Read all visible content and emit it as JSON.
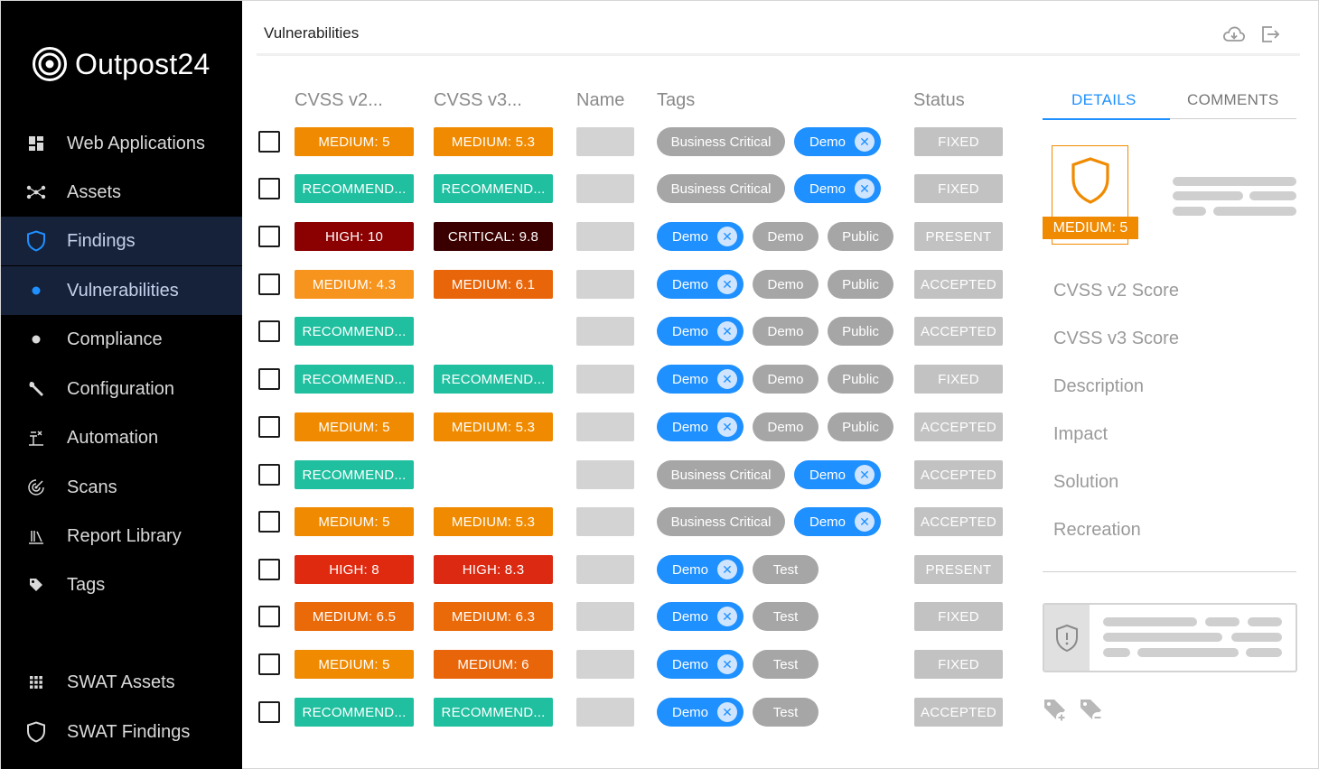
{
  "app": {
    "brand": "Outpost24",
    "page_title": "Vulnerabilities"
  },
  "sidebar": {
    "items": [
      {
        "label": "Web Applications",
        "icon": "grid-icon"
      },
      {
        "label": "Assets",
        "icon": "network-icon"
      },
      {
        "label": "Findings",
        "icon": "shield-icon"
      },
      {
        "label": "Vulnerabilities",
        "icon": "dot-icon"
      },
      {
        "label": "Compliance",
        "icon": "dot-icon"
      },
      {
        "label": "Configuration",
        "icon": "wrench-icon"
      },
      {
        "label": "Automation",
        "icon": "automation-icon"
      },
      {
        "label": "Scans",
        "icon": "radar-icon"
      },
      {
        "label": "Report Library",
        "icon": "library-icon"
      },
      {
        "label": "Tags",
        "icon": "tag-icon"
      },
      {
        "label": "SWAT Assets",
        "icon": "apps-grid-icon"
      },
      {
        "label": "SWAT Findings",
        "icon": "shield-outline-icon"
      }
    ]
  },
  "table": {
    "columns": [
      "CVSS v2...",
      "CVSS v3...",
      "Name",
      "Tags",
      "Status"
    ],
    "rows": [
      {
        "v2": "MEDIUM: 5",
        "v3": "MEDIUM: 5.3",
        "tags": [
          {
            "label": "Business Critical",
            "style": "grey"
          },
          {
            "label": "Demo",
            "style": "blue"
          }
        ],
        "status": "FIXED"
      },
      {
        "v2": "RECOMMEND...",
        "v3": "RECOMMEND...",
        "tags": [
          {
            "label": "Business Critical",
            "style": "grey"
          },
          {
            "label": "Demo",
            "style": "blue"
          }
        ],
        "status": "FIXED"
      },
      {
        "v2": "HIGH: 10",
        "v3": "CRITICAL: 9.8",
        "tags": [
          {
            "label": "Demo",
            "style": "blue"
          },
          {
            "label": "Demo",
            "style": "grey"
          },
          {
            "label": "Public",
            "style": "grey"
          }
        ],
        "status": "PRESENT"
      },
      {
        "v2": "MEDIUM: 4.3",
        "v3": "MEDIUM: 6.1",
        "tags": [
          {
            "label": "Demo",
            "style": "blue"
          },
          {
            "label": "Demo",
            "style": "grey"
          },
          {
            "label": "Public",
            "style": "grey"
          }
        ],
        "status": "ACCEPTED"
      },
      {
        "v2": "RECOMMEND...",
        "v3": "",
        "tags": [
          {
            "label": "Demo",
            "style": "blue"
          },
          {
            "label": "Demo",
            "style": "grey"
          },
          {
            "label": "Public",
            "style": "grey"
          }
        ],
        "status": "ACCEPTED"
      },
      {
        "v2": "RECOMMEND...",
        "v3": "RECOMMEND...",
        "tags": [
          {
            "label": "Demo",
            "style": "blue"
          },
          {
            "label": "Demo",
            "style": "grey"
          },
          {
            "label": "Public",
            "style": "grey"
          }
        ],
        "status": "FIXED"
      },
      {
        "v2": "MEDIUM: 5",
        "v3": "MEDIUM: 5.3",
        "tags": [
          {
            "label": "Demo",
            "style": "blue"
          },
          {
            "label": "Demo",
            "style": "grey"
          },
          {
            "label": "Public",
            "style": "grey"
          }
        ],
        "status": "ACCEPTED"
      },
      {
        "v2": "RECOMMEND...",
        "v3": "",
        "tags": [
          {
            "label": "Business Critical",
            "style": "grey"
          },
          {
            "label": "Demo",
            "style": "blue"
          }
        ],
        "status": "ACCEPTED"
      },
      {
        "v2": "MEDIUM: 5",
        "v3": "MEDIUM: 5.3",
        "tags": [
          {
            "label": "Business Critical",
            "style": "grey"
          },
          {
            "label": "Demo",
            "style": "blue"
          }
        ],
        "status": "ACCEPTED"
      },
      {
        "v2": "HIGH: 8",
        "v3": "HIGH: 8.3",
        "tags": [
          {
            "label": "Demo",
            "style": "blue"
          },
          {
            "label": "Test",
            "style": "grey"
          }
        ],
        "status": "PRESENT"
      },
      {
        "v2": "MEDIUM: 6.5",
        "v3": "MEDIUM: 6.3",
        "tags": [
          {
            "label": "Demo",
            "style": "blue"
          },
          {
            "label": "Test",
            "style": "grey"
          }
        ],
        "status": "FIXED"
      },
      {
        "v2": "MEDIUM: 5",
        "v3": "MEDIUM: 6",
        "tags": [
          {
            "label": "Demo",
            "style": "blue"
          },
          {
            "label": "Test",
            "style": "grey"
          }
        ],
        "status": "FIXED"
      },
      {
        "v2": "RECOMMEND...",
        "v3": "RECOMMEND...",
        "tags": [
          {
            "label": "Demo",
            "style": "blue"
          },
          {
            "label": "Test",
            "style": "grey"
          }
        ],
        "status": "ACCEPTED"
      }
    ]
  },
  "severity_colors": {
    "MEDIUM: 5": "#f08a00",
    "MEDIUM: 5.3": "#f08a00",
    "RECOMMEND...": "#1fbf9f",
    "HIGH: 10": "#8b0000",
    "CRITICAL: 9.8": "#3a0000",
    "MEDIUM: 4.3": "#f7941d",
    "MEDIUM: 6.1": "#e8650a",
    "HIGH: 8": "#e02a10",
    "HIGH: 8.3": "#dc2a12",
    "MEDIUM: 6.5": "#ea6a0a",
    "MEDIUM: 6.3": "#ea6a0a",
    "MEDIUM: 6": "#e8650a"
  },
  "details_panel": {
    "tabs": [
      "DETAILS",
      "COMMENTS"
    ],
    "severity": "MEDIUM: 5",
    "fields": [
      "CVSS v2 Score",
      "CVSS v3 Score",
      "Description",
      "Impact",
      "Solution",
      "Recreation"
    ]
  },
  "colors": {
    "accent": "#1e90ff",
    "sidebar_bg": "#000000",
    "sidebar_active": "#16213a",
    "status_bg": "#c2c2c2",
    "tag_grey": "#a6a6a6"
  }
}
